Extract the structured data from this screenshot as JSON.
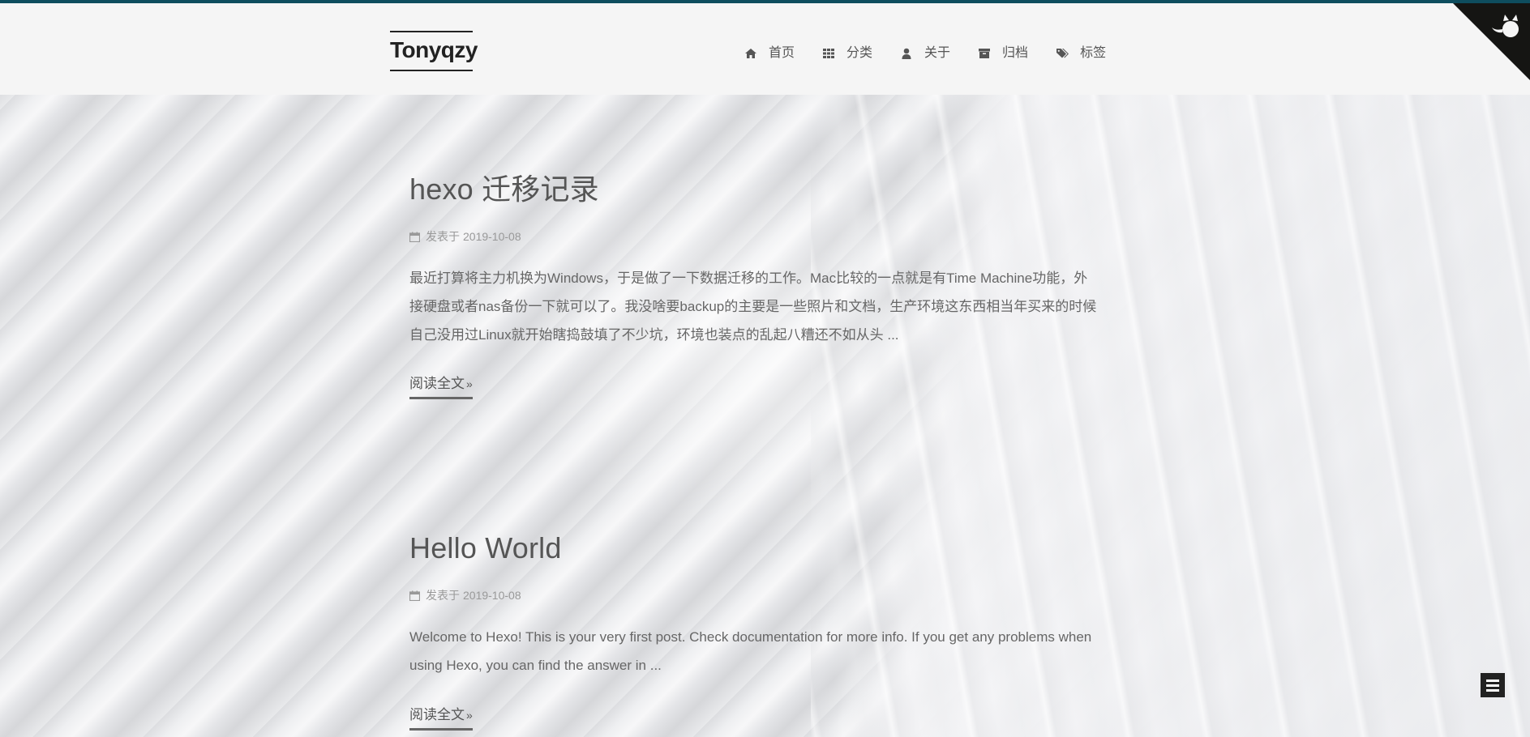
{
  "site": {
    "brand": "Tonyqzy",
    "accent_color": "#0e4d5e"
  },
  "nav": {
    "items": [
      {
        "label": "首页",
        "icon": "home-icon"
      },
      {
        "label": "分类",
        "icon": "th-grid-icon"
      },
      {
        "label": "关于",
        "icon": "user-icon"
      },
      {
        "label": "归档",
        "icon": "archive-icon"
      },
      {
        "label": "标签",
        "icon": "tags-icon"
      }
    ]
  },
  "corner": {
    "icon": "github-octocat-icon"
  },
  "posts": [
    {
      "title": "hexo 迁移记录",
      "meta_prefix": "发表于",
      "date": "2019-10-08",
      "excerpt_lines": [
        "最近打算将主力机换为Windows，于是做了一下数据迁移的工作。Mac比较的一点就是有Time Machine功能，外",
        "接硬盘或者nas备份一下就可以了。我没啥要backup的主要是一些照片和文档，生产环境这东西相当年买来的时候",
        "自己没用过Linux就开始瞎捣鼓填了不少坑，环境也装点的乱起八糟还不如从头 ..."
      ],
      "read_more": "阅读全文",
      "read_more_suffix": "»"
    },
    {
      "title": "Hello World",
      "meta_prefix": "发表于",
      "date": "2019-10-08",
      "excerpt_lines": [
        "Welcome to Hexo! This is your very first post. Check documentation for more info. If you get any problems when",
        "using Hexo, you can find the answer in ..."
      ],
      "read_more": "阅读全文",
      "read_more_suffix": "»"
    }
  ],
  "menu_toggle": {
    "icon": "hamburger-menu-icon"
  }
}
